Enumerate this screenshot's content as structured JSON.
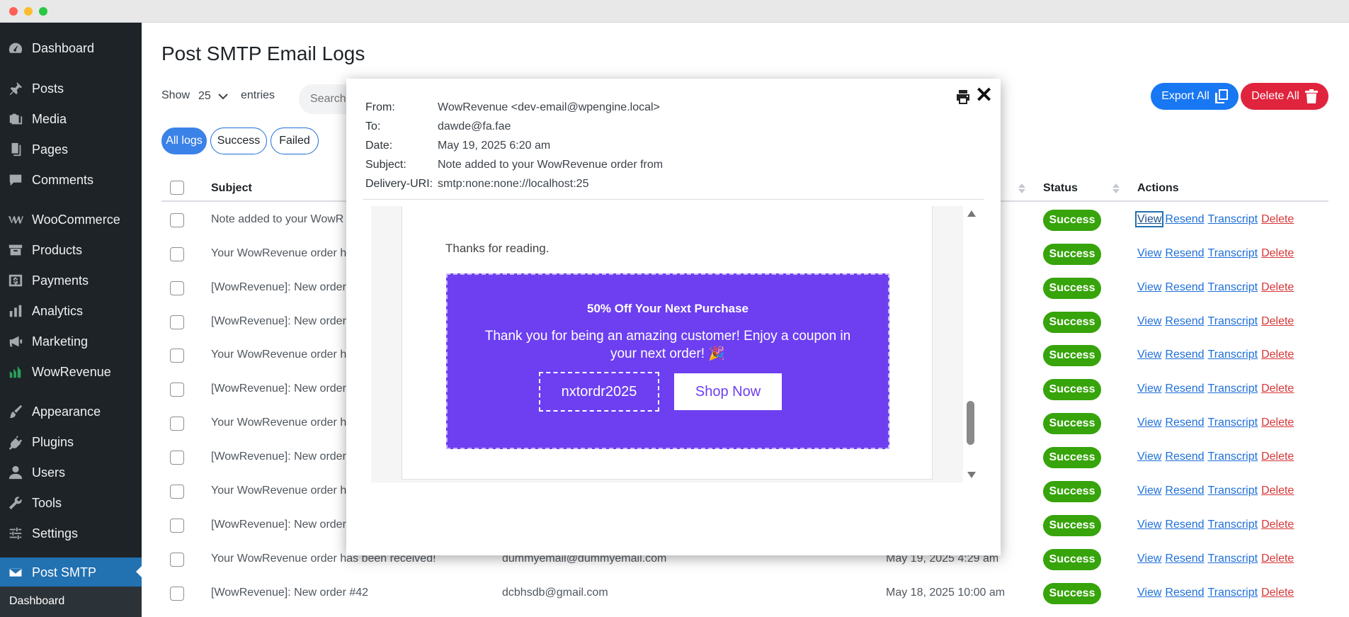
{
  "sidebar": {
    "items": [
      {
        "label": "Dashboard",
        "icon": "dashboard-icon"
      },
      {
        "label": "Posts",
        "icon": "pin-icon"
      },
      {
        "label": "Media",
        "icon": "media-icon"
      },
      {
        "label": "Pages",
        "icon": "pages-icon"
      },
      {
        "label": "Comments",
        "icon": "comments-icon"
      },
      {
        "label": "WooCommerce",
        "icon": "woocommerce-icon"
      },
      {
        "label": "Products",
        "icon": "products-icon"
      },
      {
        "label": "Payments",
        "icon": "payments-icon"
      },
      {
        "label": "Analytics",
        "icon": "analytics-icon"
      },
      {
        "label": "Marketing",
        "icon": "marketing-icon"
      },
      {
        "label": "WowRevenue",
        "icon": "wowrevenue-icon"
      },
      {
        "label": "Appearance",
        "icon": "appearance-icon"
      },
      {
        "label": "Plugins",
        "icon": "plugins-icon"
      },
      {
        "label": "Users",
        "icon": "users-icon"
      },
      {
        "label": "Tools",
        "icon": "tools-icon"
      },
      {
        "label": "Settings",
        "icon": "settings-icon"
      },
      {
        "label": "Post SMTP",
        "icon": "mail-icon"
      }
    ],
    "submenu_label": "Dashboard"
  },
  "page": {
    "title": "Post SMTP Email Logs",
    "show_label": "Show",
    "show_value": "25",
    "entries_label": "entries",
    "search_placeholder": "Search",
    "export_label": "Export All",
    "delete_all_label": "Delete All"
  },
  "filters": [
    "All logs",
    "Success",
    "Failed"
  ],
  "table": {
    "headers": {
      "subject": "Subject",
      "status": "Status",
      "actions": "Actions"
    },
    "action_labels": {
      "view": "View",
      "resend": "Resend",
      "transcript": "Transcript",
      "delete": "Delete"
    },
    "rows": [
      {
        "subject": "Note added to your WowR",
        "to": "",
        "date": "",
        "status": "Success"
      },
      {
        "subject": "Your WowRevenue order h",
        "to": "",
        "date": "",
        "status": "Success"
      },
      {
        "subject": "[WowRevenue]: New order",
        "to": "",
        "date": "",
        "status": "Success"
      },
      {
        "subject": "[WowRevenue]: New order",
        "to": "",
        "date": "",
        "status": "Success"
      },
      {
        "subject": "Your WowRevenue order h",
        "to": "",
        "date": "",
        "status": "Success"
      },
      {
        "subject": "[WowRevenue]: New order",
        "to": "",
        "date": "",
        "status": "Success"
      },
      {
        "subject": "Your WowRevenue order h",
        "to": "",
        "date": "",
        "status": "Success"
      },
      {
        "subject": "[WowRevenue]: New order",
        "to": "",
        "date": "",
        "status": "Success"
      },
      {
        "subject": "Your WowRevenue order h",
        "to": "",
        "date": "",
        "status": "Success"
      },
      {
        "subject": "[WowRevenue]: New order",
        "to": "",
        "date": "",
        "status": "Success"
      },
      {
        "subject": "Your WowRevenue order has been received!",
        "to": "dummyemail@dummyemail.com",
        "date": "May 19, 2025 4:29 am",
        "status": "Success"
      },
      {
        "subject": "[WowRevenue]: New order #42",
        "to": "dcbhsdb@gmail.com",
        "date": "May 18, 2025 10:00 am",
        "status": "Success"
      }
    ]
  },
  "modal": {
    "from_label": "From:",
    "from_value": "WowRevenue <dev-email@wpengine.local>",
    "to_label": "To:",
    "to_value": "dawde@fa.fae",
    "date_label": "Date:",
    "date_value": "May 19, 2025 6:20 am",
    "subject_label": "Subject:",
    "subject_value": "Note added to your WowRevenue order from",
    "uri_label": "Delivery-URI:",
    "uri_value": "smtp:none:none://localhost:25",
    "close_symbol": "✕",
    "email": {
      "thanks": "Thanks for reading.",
      "promo_title": "50% Off Your Next Purchase",
      "promo_text": "Thank you for being an amazing customer! Enjoy a coupon in your next order! 🎉",
      "coupon_code": "nxtordr2025",
      "shop_label": "Shop Now"
    }
  },
  "colors": {
    "sidebar_bg": "#1d2327",
    "active_menu": "#2271b1",
    "success": "#36a40a",
    "export_btn": "#1877f2",
    "delete_btn": "#e0243d",
    "promo_bg": "#6d3ff0"
  }
}
